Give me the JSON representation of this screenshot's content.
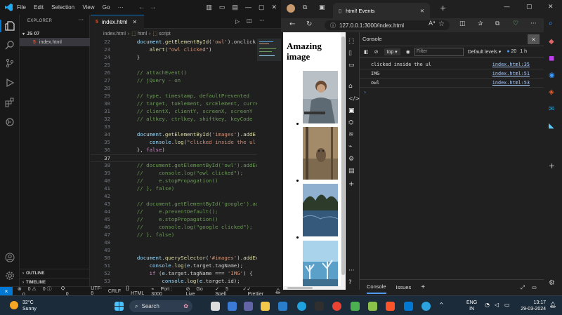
{
  "vscode": {
    "menu": [
      "File",
      "Edit",
      "Selection",
      "View",
      "Go",
      "···"
    ],
    "sidebar": {
      "header": "EXPLORER",
      "folder": "JS 07",
      "file": "index.html",
      "outline": "OUTLINE",
      "timeline": "TIMELINE"
    },
    "tab": "index.html",
    "breadcrumb": [
      "index.html",
      "html",
      "script"
    ],
    "code_lines": [
      {
        "n": "22",
        "t": "    document.getElementById('owl').onclick"
      },
      {
        "n": "23",
        "t": "        alert(\"owl clicked\")"
      },
      {
        "n": "24",
        "t": "    }"
      },
      {
        "n": "25",
        "t": ""
      },
      {
        "n": "26",
        "t": "    // attachEvent()"
      },
      {
        "n": "27",
        "t": "    // jQuery - on"
      },
      {
        "n": "28",
        "t": ""
      },
      {
        "n": "29",
        "t": "    // type, timestamp, defaultPrevented"
      },
      {
        "n": "30",
        "t": "    // target, toElement, srcElement, curre"
      },
      {
        "n": "31",
        "t": "    // clientX, clientY, screenX, screenY"
      },
      {
        "n": "32",
        "t": "    // altkey, ctrlkey, shiftkey, keyCode"
      },
      {
        "n": "33",
        "t": ""
      },
      {
        "n": "34",
        "t": "    document.getElementById('images').addE"
      },
      {
        "n": "35",
        "t": "        console.log(\"clicked inside the ul"
      },
      {
        "n": "36",
        "t": "    }, false)"
      },
      {
        "n": "37",
        "t": ""
      },
      {
        "n": "38",
        "t": "    // document.getElementById('owl').addEv"
      },
      {
        "n": "39",
        "t": "    //     console.log(\"owl clicked\");"
      },
      {
        "n": "40",
        "t": "    //     e.stopPropagation()"
      },
      {
        "n": "41",
        "t": "    // }, false)"
      },
      {
        "n": "42",
        "t": ""
      },
      {
        "n": "43",
        "t": "    // document.getElementById('google').ad"
      },
      {
        "n": "44",
        "t": "    //     e.preventDefault();"
      },
      {
        "n": "45",
        "t": "    //     e.stopPropagation()"
      },
      {
        "n": "46",
        "t": "    //     console.log(\"google clicked\");"
      },
      {
        "n": "47",
        "t": "    // }, false)"
      },
      {
        "n": "48",
        "t": ""
      },
      {
        "n": "49",
        "t": ""
      },
      {
        "n": "50",
        "t": "    document.querySelector('#images').addEv"
      },
      {
        "n": "51",
        "t": "        console.log(e.target.tagName);"
      },
      {
        "n": "52",
        "t": "        if (e.target.tagName === 'IMG') {"
      },
      {
        "n": "53",
        "t": "            console.log(e.target.id);"
      }
    ],
    "status": {
      "errors": "0",
      "warnings": "0",
      "info": "0",
      "ports": "0",
      "encoding": "UTF-8",
      "eol": "CRLF",
      "language": "HTML",
      "port": "Port : 3000",
      "golive": "Go Live",
      "spell": "5 Spell",
      "prettier": "Prettier"
    }
  },
  "browser": {
    "tab_title": "html! Events",
    "url": "127.0.0.1:3000/index.html",
    "page_heading": "Amazing image",
    "devtools": {
      "panel": "Console",
      "context": "top",
      "filter_placeholder": "Filter",
      "levels": "Default levels",
      "issue_count": "20",
      "hidden": "1 h",
      "logs": [
        {
          "msg": "clicked inside the ul",
          "src": "index.html:35"
        },
        {
          "msg": "IMG",
          "src": "index.html:51"
        },
        {
          "msg": "owl",
          "src": "index.html:53"
        }
      ],
      "footer_tabs": [
        "Console",
        "Issues"
      ]
    }
  },
  "taskbar": {
    "temp": "32°C",
    "weather": "Sunny",
    "search": "Search",
    "lang1": "ENG",
    "lang2": "IN",
    "time": "13:17",
    "date": "29-03-2024"
  },
  "colors": {
    "vscode_accent": "#0078d4",
    "comment": "#6a9955",
    "string": "#ce9178",
    "function": "#dcdcaa",
    "keyword": "#c586c0",
    "variable": "#9cdcfe"
  }
}
